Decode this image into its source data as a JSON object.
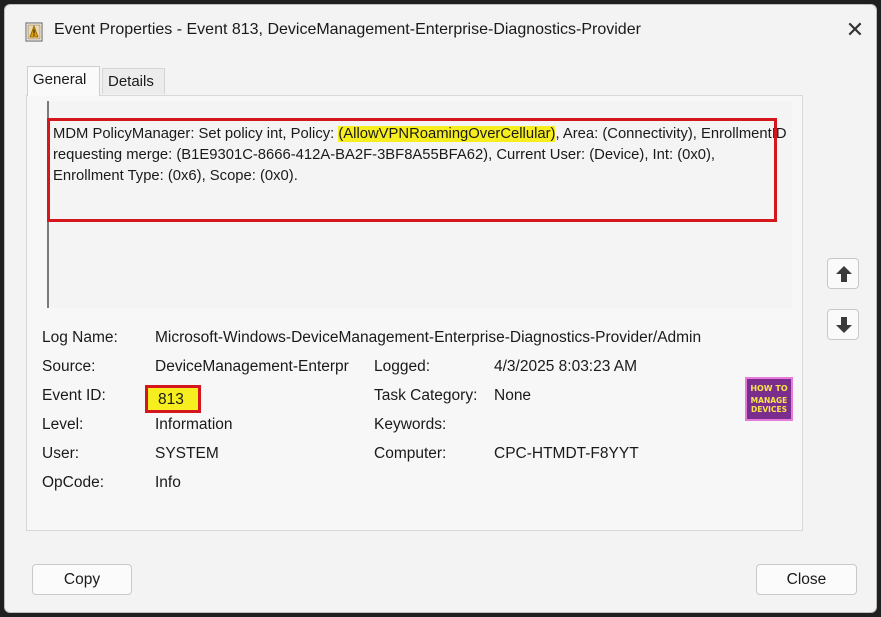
{
  "window": {
    "title": "Event Properties - Event 813, DeviceManagement-Enterprise-Diagnostics-Provider",
    "close_glyph": "✕"
  },
  "tabs": [
    {
      "label": "General",
      "active": true
    },
    {
      "label": "Details",
      "active": false
    }
  ],
  "description": {
    "part1": "MDM PolicyManager: Set policy int, Policy: ",
    "policy": "(AllowVPNRoamingOverCellular)",
    "part2": ", Area: (Connectivity), EnrollmentID requesting merge: (B1E9301C-8666-412A-BA2F-3BF8A55BFA62), Current User: (Device), Int: (0x0), Enrollment Type: (0x6), Scope: (0x0)."
  },
  "fields": {
    "log_name": {
      "label": "Log Name:",
      "value": "Microsoft-Windows-DeviceManagement-Enterprise-Diagnostics-Provider/Admin"
    },
    "source": {
      "label": "Source:",
      "value": "DeviceManagement-Enterpr"
    },
    "logged": {
      "label": "Logged:",
      "value": "4/3/2025 8:03:23 AM"
    },
    "event_id": {
      "label": "Event ID:",
      "value": "813"
    },
    "task_category": {
      "label": "Task Category:",
      "value": "None"
    },
    "level": {
      "label": "Level:",
      "value": "Information"
    },
    "keywords": {
      "label": "Keywords:",
      "value": ""
    },
    "user": {
      "label": "User:",
      "value": "SYSTEM"
    },
    "computer": {
      "label": "Computer:",
      "value": "CPC-HTMDT-F8YYT"
    },
    "opcode": {
      "label": "OpCode:",
      "value": "Info"
    }
  },
  "logo": {
    "line1": "HOW TO",
    "line2": "MANAGE",
    "line3": "DEVICES"
  },
  "buttons": {
    "copy": "Copy",
    "close": "Close"
  },
  "icons": [
    "event-viewer-icon",
    "close-icon",
    "arrow-up-icon",
    "arrow-down-icon"
  ],
  "colors": {
    "highlight": "#f6ee1e",
    "annotation_red": "#d4161d",
    "logo_bg": "#7a2d8c"
  }
}
